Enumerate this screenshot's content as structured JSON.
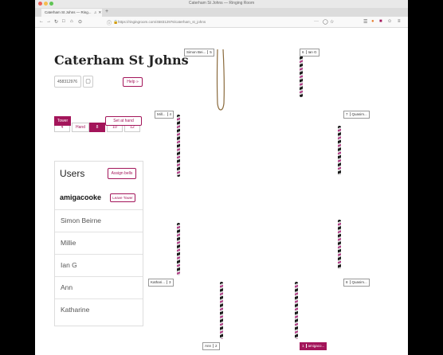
{
  "browser": {
    "window_title": "Caterham St Johns — Ringing Room",
    "tab_title": "Caterham St Johns — Ring...",
    "url": "https://ringingroom.com/458312976/caterham_st_johns"
  },
  "sidebar": {
    "tower_name": "Caterham St Johns",
    "tower_id": "458312976",
    "help_label": "Help »",
    "bell_counts": [
      "4",
      "6",
      "8",
      "10",
      "12"
    ],
    "selected_bell_count": "8",
    "mode_tabs": [
      "Tower",
      "Hand"
    ],
    "selected_mode": "Tower",
    "set_at_hand_label": "Set at hand",
    "users_heading": "Users",
    "assign_bells_label": "Assign bells",
    "current_user": "amigacooke",
    "leave_tower_label": "Leave Tower",
    "users": [
      "Simon Beirne",
      "Millie",
      "Ian G",
      "Ann",
      "Katharine"
    ]
  },
  "bells": [
    {
      "number": "5",
      "name": "Simon Bei..."
    },
    {
      "number": "6",
      "name": "Ian G"
    },
    {
      "number": "4",
      "name": "Mill..."
    },
    {
      "number": "7",
      "name": "Quasim..."
    },
    {
      "number": "3",
      "name": "Kathari..."
    },
    {
      "number": "8",
      "name": "Quasim..."
    },
    {
      "number": "2",
      "name": "Ann"
    },
    {
      "number": "1",
      "name": "amigaco..."
    }
  ],
  "colors": {
    "accent": "#a3155a"
  }
}
